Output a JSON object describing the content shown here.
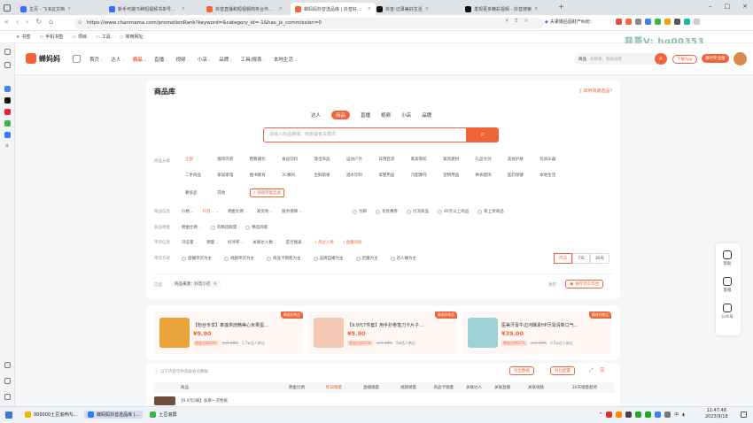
{
  "browser": {
    "tabs": [
      {
        "label": "主页 - 飞书云文档",
        "color": "#3370ff"
      },
      {
        "label": "新手可做!5种短视频书单号、具",
        "color": "#3370ff"
      },
      {
        "label": "抖音直播和短视频商务合作模式",
        "color": "#f0643a"
      },
      {
        "label": "蝉妈妈抖音选品库 | 抖音好物|找",
        "color": "#f0643a"
      },
      {
        "label": "抖音-记录美好生活",
        "color": "#111111"
      },
      {
        "label": "发现更多精彩视频 - 抖音搜索",
        "color": "#111111"
      }
    ],
    "active_tab": 3,
    "url": "https://www.chanmama.com/promotionRank?keyword=&category_id=-1&has_jx_commission=0",
    "address_right": "夫妻婚后因财产纠纷：",
    "bookmarks": [
      "书签",
      "手机书签",
      "项目",
      "工具",
      "常用网址"
    ],
    "watermark": "异哥V: hg00353"
  },
  "site": {
    "logo": "蝉妈妈",
    "nav": [
      {
        "label": "首页",
        "dropdown": true
      },
      {
        "label": "达人",
        "dropdown": true
      },
      {
        "label": "商品",
        "dropdown": true,
        "active": true
      },
      {
        "label": "直播",
        "dropdown": true
      },
      {
        "label": "视频",
        "dropdown": true
      },
      {
        "label": "小店",
        "dropdown": true
      },
      {
        "label": "品牌",
        "dropdown": true
      },
      {
        "label": "工具/报表",
        "dropdown": true
      },
      {
        "label": "本地生活",
        "dropdown": true
      }
    ],
    "search_scope": "商品",
    "search_placeholder": "如搜索，粘贴链接",
    "download_app": "下载App",
    "upgrade": "限时专业版"
  },
  "page": {
    "title": "商品库",
    "help_link": "如何快速选品?",
    "search_tabs": [
      "达人",
      "商品",
      "直播",
      "视频",
      "小店",
      "品牌"
    ],
    "search_tab_active": 1,
    "search_placeholder": "请输入商品链接、标题或者关键词",
    "filters": {
      "category_label": "商品分类",
      "categories_row1": [
        "全部",
        "服饰内衣",
        "鞋靴箱包",
        "食品饮料",
        "珠宝饰品",
        "运动户外",
        "日用百货",
        "家居家纺",
        "家具建材",
        "礼品文创",
        "美妆护肤",
        "玩具乐器"
      ],
      "categories_row2": [
        "二手商品",
        "家居家电",
        "图书教育",
        "3C数码",
        "生鲜蔬果",
        "酒水饮料",
        "母婴用品",
        "汽配摩托",
        "宠物用品",
        "钟表配饰",
        "医药保健",
        "本地生活"
      ],
      "categories_row3": [
        "奢侈品",
        "其他"
      ],
      "category_more": "快速检索品类",
      "info_label": "商品信息",
      "info_items": [
        "价格",
        "抖音…",
        "佣金比例",
        "发货地",
        "服务保障"
      ],
      "info_checks": [
        "包邮",
        "有优惠券",
        "引流商品",
        "40元以上商品",
        "新上架商品"
      ],
      "commission_label": "商品佣金",
      "commission_items": [
        "佣金比例"
      ],
      "commission_checks": [
        "有精选联盟",
        "精选商家"
      ],
      "data_label": "带货信息",
      "data_items": [
        "浏览量",
        "销量",
        "好评率",
        "关联达人数",
        "是否图表"
      ],
      "data_links": [
        "热达人榜",
        "直播间榜"
      ],
      "method_label": "带货方式",
      "method_radios": [
        "直播带货为主",
        "视频带货为主",
        "商品卡销售为主",
        "品牌自播为主",
        "店播为主",
        "达人播为主"
      ],
      "periods": [
        "昨天",
        "7天",
        "30天"
      ],
      "period_active": 0
    },
    "selected_label": "已选",
    "selected_tag": "商品来源：抖音小店",
    "clear": "清空",
    "save_view": "保存到工作台"
  },
  "promos": [
    {
      "title": "【粉丝专享】革莲烘焙精美心米果蛋…",
      "price": "¥9.90",
      "commission": "佣金比例20%",
      "orig": "公开 15%",
      "sales": "1.7w达人带过",
      "badge": "精选好商品"
    },
    {
      "title": "【9.9元7件套】用手抄卷笔刀卡片子…",
      "price": "¥9.90",
      "commission": "佣金比例55%",
      "orig": "公开 40%",
      "sales": "5w达人带过",
      "badge": "精选好商品"
    },
    {
      "title": "医美牙膏牛边河酵素HP牙膏清新口气…",
      "price": "¥39.00",
      "commission": "佣金比例37%",
      "orig": "公开 20%",
      "sales": "0.5w达人带过",
      "badge": "精选好商品"
    }
  ],
  "table": {
    "notice": "以下内容仅供高级会员数据",
    "export": "导出数据",
    "compare": "对比配置",
    "headers": [
      "商品",
      "佣金比例",
      "昨日销量",
      "直播销量",
      "视频销量",
      "商品卡销量",
      "关联达人",
      "关联直播",
      "关联视频",
      "30天销量趋势"
    ],
    "sort_col": 2,
    "first_row": "【9.9元2册】加厚一次性纸"
  },
  "right_panel": [
    "帮助",
    "客服",
    "公众号"
  ],
  "taskbar": {
    "items": [
      "000000土豆滚养内…",
      "蝉妈妈抖音选品库 |…",
      "土豆滚屏"
    ],
    "time": "11:47:48",
    "date": "2023/9/18",
    "lang": "中"
  }
}
